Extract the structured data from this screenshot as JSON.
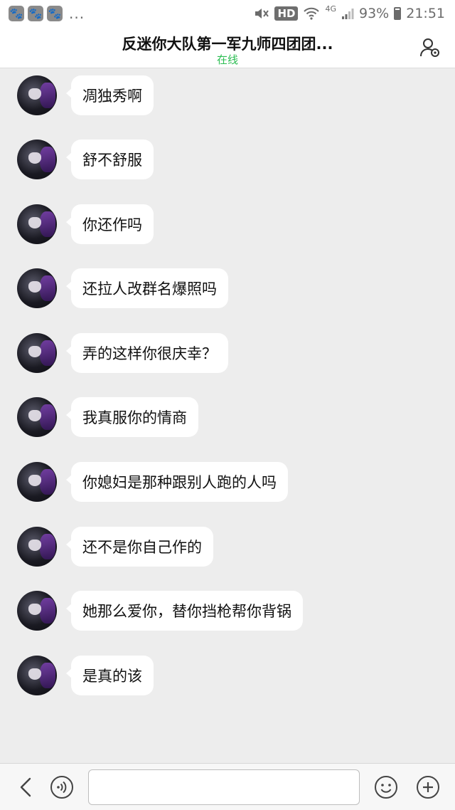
{
  "status_bar": {
    "app_icons": [
      "paw-icon",
      "paw-icon",
      "paw-icon"
    ],
    "overflow": "...",
    "hd": "HD",
    "network": "4G",
    "battery": "93%",
    "time": "21:51"
  },
  "header": {
    "title": "反迷你大队第一军九师四团团...",
    "status": "在线"
  },
  "messages": [
    {
      "text": "凋独秀啊"
    },
    {
      "text": "舒不舒服"
    },
    {
      "text": "你还作吗"
    },
    {
      "text": "还拉人改群名爆照吗"
    },
    {
      "text": "弄的这样你很庆幸？"
    },
    {
      "text": "我真服你的情商"
    },
    {
      "text": "你媳妇是那种跟别人跑的人吗"
    },
    {
      "text": "还不是你自己作的"
    },
    {
      "text": "她那么爱你，替你挡枪帮你背锅"
    },
    {
      "text": "是真的该"
    }
  ],
  "input": {
    "value": "",
    "placeholder": ""
  },
  "colors": {
    "online": "#2bbd52",
    "chat_background": "#ededed",
    "bubble": "#ffffff"
  }
}
